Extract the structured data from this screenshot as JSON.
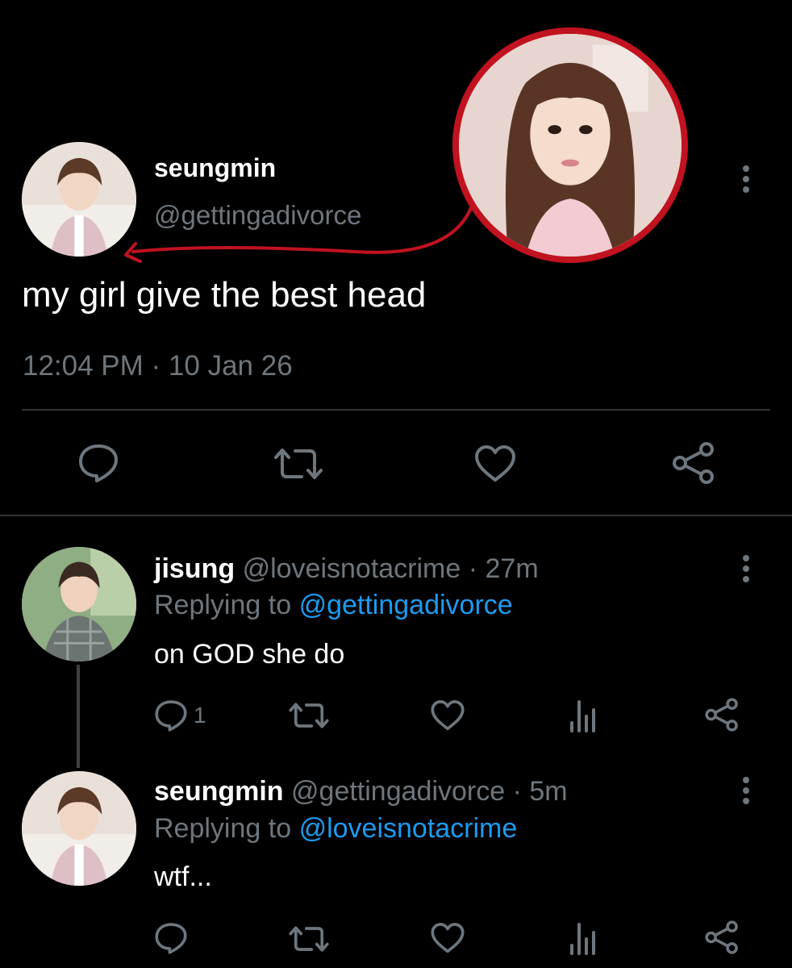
{
  "main_tweet": {
    "display_name": "seungmin",
    "handle": "@gettingadivorce",
    "text": "my girl give the best head",
    "timestamp": "12:04 PM · 10 Jan 26"
  },
  "replies": [
    {
      "display_name": "jisung",
      "handle": "@loveisnotacrime",
      "time": "· 27m",
      "replying_prefix": "Replying to",
      "replying_to": "@gettingadivorce",
      "text": "on GOD she do",
      "reply_count": "1"
    },
    {
      "display_name": "seungmin",
      "handle": "@gettingadivorce",
      "time": "· 5m",
      "replying_prefix": "Replying to",
      "replying_to": "@loveisnotacrime",
      "text": "wtf...",
      "reply_count": ""
    }
  ],
  "colors": {
    "background": "#000000",
    "text": "#e7e9ea",
    "muted": "#6e767d",
    "link": "#1d9bf0",
    "annotation_red": "#c1121f"
  },
  "icons": [
    "reply-icon",
    "retweet-icon",
    "like-icon",
    "share-icon",
    "analytics-icon",
    "more-options-icon"
  ]
}
